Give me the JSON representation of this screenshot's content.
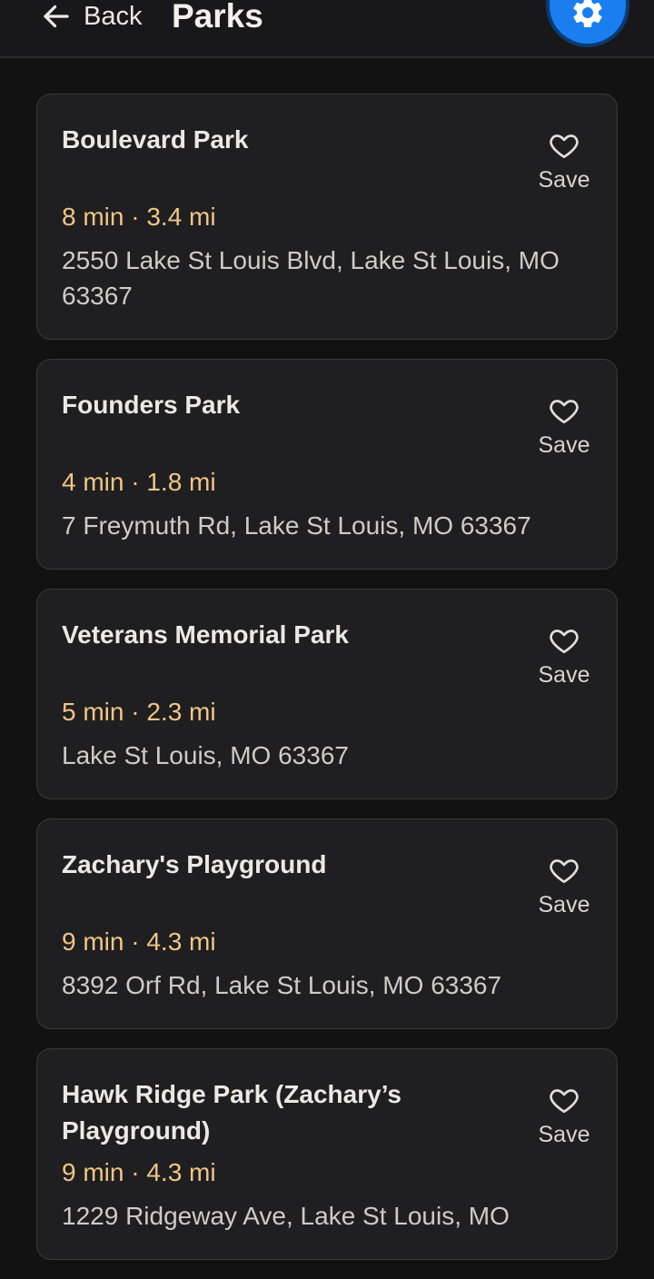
{
  "header": {
    "back_label": "Back",
    "title": "Parks",
    "settings_icon": "gear-icon"
  },
  "parks": [
    {
      "name": "Boulevard Park",
      "meta": "8 min · 3.4 mi",
      "address": "2550 Lake St Louis Blvd, Lake St Louis, MO 63367",
      "save_label": "Save"
    },
    {
      "name": "Founders Park",
      "meta": "4 min · 1.8 mi",
      "address": "7 Freymuth Rd, Lake St Louis, MO 63367",
      "save_label": "Save"
    },
    {
      "name": "Veterans Memorial Park",
      "meta": "5 min · 2.3 mi",
      "address": "Lake St Louis, MO 63367",
      "save_label": "Save"
    },
    {
      "name": "Zachary's Playground",
      "meta": "9 min · 4.3 mi",
      "address": "8392 Orf Rd, Lake St Louis, MO 63367",
      "save_label": "Save"
    },
    {
      "name": "Hawk Ridge Park (Zachary’s Playground)",
      "meta": "9 min · 4.3 mi",
      "address": "1229 Ridgeway Ave, Lake St Louis, MO",
      "save_label": "Save"
    }
  ],
  "colors": {
    "accent": "#1a7ef0",
    "meta_text": "#f0c684",
    "background": "#121213",
    "card": "#1f1f22"
  }
}
